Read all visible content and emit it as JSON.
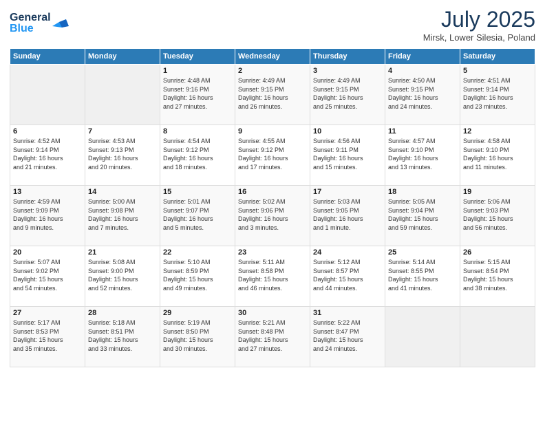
{
  "header": {
    "logo_line1": "General",
    "logo_line2": "Blue",
    "month_year": "July 2025",
    "location": "Mirsk, Lower Silesia, Poland"
  },
  "weekdays": [
    "Sunday",
    "Monday",
    "Tuesday",
    "Wednesday",
    "Thursday",
    "Friday",
    "Saturday"
  ],
  "weeks": [
    [
      {
        "day": "",
        "detail": ""
      },
      {
        "day": "",
        "detail": ""
      },
      {
        "day": "1",
        "detail": "Sunrise: 4:48 AM\nSunset: 9:16 PM\nDaylight: 16 hours\nand 27 minutes."
      },
      {
        "day": "2",
        "detail": "Sunrise: 4:49 AM\nSunset: 9:15 PM\nDaylight: 16 hours\nand 26 minutes."
      },
      {
        "day": "3",
        "detail": "Sunrise: 4:49 AM\nSunset: 9:15 PM\nDaylight: 16 hours\nand 25 minutes."
      },
      {
        "day": "4",
        "detail": "Sunrise: 4:50 AM\nSunset: 9:15 PM\nDaylight: 16 hours\nand 24 minutes."
      },
      {
        "day": "5",
        "detail": "Sunrise: 4:51 AM\nSunset: 9:14 PM\nDaylight: 16 hours\nand 23 minutes."
      }
    ],
    [
      {
        "day": "6",
        "detail": "Sunrise: 4:52 AM\nSunset: 9:14 PM\nDaylight: 16 hours\nand 21 minutes."
      },
      {
        "day": "7",
        "detail": "Sunrise: 4:53 AM\nSunset: 9:13 PM\nDaylight: 16 hours\nand 20 minutes."
      },
      {
        "day": "8",
        "detail": "Sunrise: 4:54 AM\nSunset: 9:12 PM\nDaylight: 16 hours\nand 18 minutes."
      },
      {
        "day": "9",
        "detail": "Sunrise: 4:55 AM\nSunset: 9:12 PM\nDaylight: 16 hours\nand 17 minutes."
      },
      {
        "day": "10",
        "detail": "Sunrise: 4:56 AM\nSunset: 9:11 PM\nDaylight: 16 hours\nand 15 minutes."
      },
      {
        "day": "11",
        "detail": "Sunrise: 4:57 AM\nSunset: 9:10 PM\nDaylight: 16 hours\nand 13 minutes."
      },
      {
        "day": "12",
        "detail": "Sunrise: 4:58 AM\nSunset: 9:10 PM\nDaylight: 16 hours\nand 11 minutes."
      }
    ],
    [
      {
        "day": "13",
        "detail": "Sunrise: 4:59 AM\nSunset: 9:09 PM\nDaylight: 16 hours\nand 9 minutes."
      },
      {
        "day": "14",
        "detail": "Sunrise: 5:00 AM\nSunset: 9:08 PM\nDaylight: 16 hours\nand 7 minutes."
      },
      {
        "day": "15",
        "detail": "Sunrise: 5:01 AM\nSunset: 9:07 PM\nDaylight: 16 hours\nand 5 minutes."
      },
      {
        "day": "16",
        "detail": "Sunrise: 5:02 AM\nSunset: 9:06 PM\nDaylight: 16 hours\nand 3 minutes."
      },
      {
        "day": "17",
        "detail": "Sunrise: 5:03 AM\nSunset: 9:05 PM\nDaylight: 16 hours\nand 1 minute."
      },
      {
        "day": "18",
        "detail": "Sunrise: 5:05 AM\nSunset: 9:04 PM\nDaylight: 15 hours\nand 59 minutes."
      },
      {
        "day": "19",
        "detail": "Sunrise: 5:06 AM\nSunset: 9:03 PM\nDaylight: 15 hours\nand 56 minutes."
      }
    ],
    [
      {
        "day": "20",
        "detail": "Sunrise: 5:07 AM\nSunset: 9:02 PM\nDaylight: 15 hours\nand 54 minutes."
      },
      {
        "day": "21",
        "detail": "Sunrise: 5:08 AM\nSunset: 9:00 PM\nDaylight: 15 hours\nand 52 minutes."
      },
      {
        "day": "22",
        "detail": "Sunrise: 5:10 AM\nSunset: 8:59 PM\nDaylight: 15 hours\nand 49 minutes."
      },
      {
        "day": "23",
        "detail": "Sunrise: 5:11 AM\nSunset: 8:58 PM\nDaylight: 15 hours\nand 46 minutes."
      },
      {
        "day": "24",
        "detail": "Sunrise: 5:12 AM\nSunset: 8:57 PM\nDaylight: 15 hours\nand 44 minutes."
      },
      {
        "day": "25",
        "detail": "Sunrise: 5:14 AM\nSunset: 8:55 PM\nDaylight: 15 hours\nand 41 minutes."
      },
      {
        "day": "26",
        "detail": "Sunrise: 5:15 AM\nSunset: 8:54 PM\nDaylight: 15 hours\nand 38 minutes."
      }
    ],
    [
      {
        "day": "27",
        "detail": "Sunrise: 5:17 AM\nSunset: 8:53 PM\nDaylight: 15 hours\nand 35 minutes."
      },
      {
        "day": "28",
        "detail": "Sunrise: 5:18 AM\nSunset: 8:51 PM\nDaylight: 15 hours\nand 33 minutes."
      },
      {
        "day": "29",
        "detail": "Sunrise: 5:19 AM\nSunset: 8:50 PM\nDaylight: 15 hours\nand 30 minutes."
      },
      {
        "day": "30",
        "detail": "Sunrise: 5:21 AM\nSunset: 8:48 PM\nDaylight: 15 hours\nand 27 minutes."
      },
      {
        "day": "31",
        "detail": "Sunrise: 5:22 AM\nSunset: 8:47 PM\nDaylight: 15 hours\nand 24 minutes."
      },
      {
        "day": "",
        "detail": ""
      },
      {
        "day": "",
        "detail": ""
      }
    ]
  ]
}
